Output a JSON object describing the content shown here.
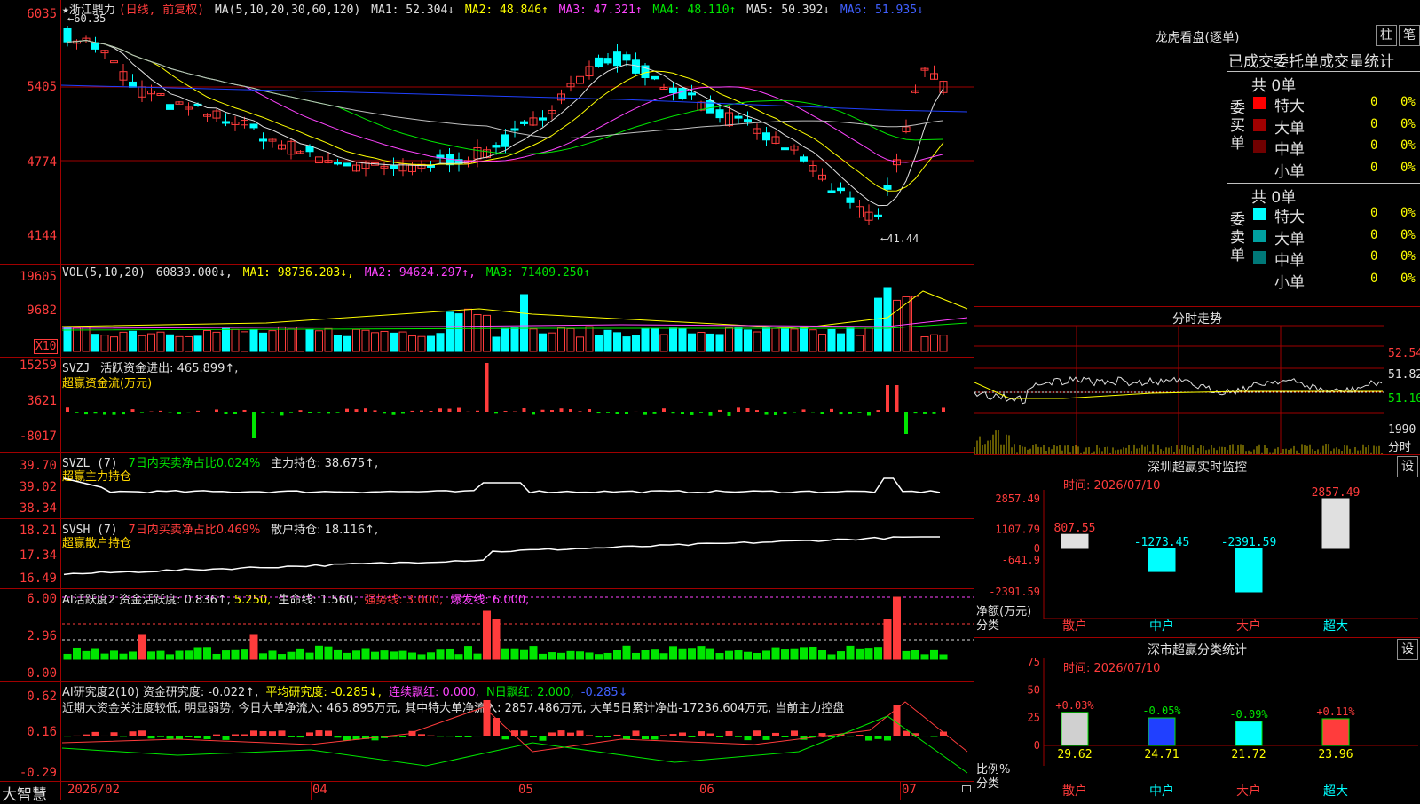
{
  "toolbar": {
    "app_name": "大智慧"
  },
  "main": {
    "stock": "★浙江鼎力",
    "mode": "(日线, 前复权)",
    "ma_label": "MA(5,10,20,30,60,120)",
    "ma": [
      "MA1: 52.304↓",
      "MA2: 48.846↑",
      "MA3: 47.321↑",
      "MA4: 48.110↑",
      "MA5: 50.392↓",
      "MA6: 51.935↓"
    ],
    "y_ticks": [
      "6035",
      "5405",
      "4774",
      "4144"
    ],
    "high_mark": "←60.35",
    "low_mark": "←41.44"
  },
  "vol": {
    "label": "VOL(5,10,20)",
    "value": "60839.000↓,",
    "ma": [
      "MA1: 98736.203↓,",
      "MA2: 94624.297↑,",
      "MA3: 71409.250↑"
    ],
    "y_ticks": [
      "19605",
      "9682"
    ],
    "unit": "X10"
  },
  "svzj": {
    "label": "SVZJ",
    "text1": "活跃资金进出: 465.899↑,",
    "text2": "超赢资金流(万元)",
    "y_ticks": [
      "15259",
      "3621",
      "-8017"
    ]
  },
  "svzl": {
    "label": "SVZL (7)",
    "t1": "7日内买卖净占比0.024%",
    "t2": "主力持仓: 38.675↑,",
    "t3": "超赢主力持仓",
    "y_ticks": [
      "39.70",
      "39.02",
      "38.34"
    ]
  },
  "svsh": {
    "label": "SVSH (7)",
    "t1": "7日内买卖净占比0.469%",
    "t2": "散户持仓: 18.116↑,",
    "t3": "超赢散户持仓",
    "y_ticks": [
      "18.21",
      "17.34",
      "16.49"
    ]
  },
  "ai1": {
    "t1": "AI活跃度2 资金活跃度: 0.836↑,",
    "t2": "5.250,",
    "t3": "生命线: 1.560,",
    "t4": "强势线: 3.000,",
    "t5": "爆发线: 6.000,",
    "y_ticks": [
      "6.00",
      "2.96",
      "0.00"
    ]
  },
  "ai2": {
    "t1": "AI研究度2(10) 资金研究度: -0.022↑,",
    "t2": "平均研究度: -0.285↓,",
    "t3": "连续飘红: 0.000,",
    "t4": "N日飘红: 2.000,",
    "t5": "-0.285↓",
    "comment": "近期大资金关注度较低, 明显弱势, 今日大单净流入: 465.895万元, 其中特大单净流入: 2857.486万元, 大单5日累计净出-17236.604万元, 当前主力控盘",
    "y_ticks": [
      "0.62",
      "0.16",
      "-0.29"
    ]
  },
  "x_axis": [
    "2026/02",
    "04",
    "05",
    "06",
    "07"
  ],
  "lhb": {
    "title": "龙虎看盘(逐单)",
    "btn1": "柱",
    "btn2": "笔",
    "subtitle": "已成交委托单成交量统计",
    "buy": {
      "side": "委买单",
      "total": "共 0单",
      "rows": [
        {
          "name": "特大",
          "v": "0",
          "p": "0%"
        },
        {
          "name": "大单",
          "v": "0",
          "p": "0%"
        },
        {
          "name": "中单",
          "v": "0",
          "p": "0%"
        },
        {
          "name": "小单",
          "v": "0",
          "p": "0%"
        }
      ]
    },
    "sell": {
      "side": "委卖单",
      "total": "共 0单",
      "rows": [
        {
          "name": "特大",
          "v": "0",
          "p": "0%"
        },
        {
          "name": "大单",
          "v": "0",
          "p": "0%"
        },
        {
          "name": "中单",
          "v": "0",
          "p": "0%"
        },
        {
          "name": "小单",
          "v": "0",
          "p": "0%"
        }
      ]
    }
  },
  "fenshi": {
    "title": "分时走势",
    "y": [
      "52.54",
      "51.82",
      "51.10"
    ],
    "vol": "1990",
    "unit": "分时"
  },
  "sz_monitor": {
    "title": "深圳超赢实时监控",
    "btn": "设",
    "time": "时间: 2026/07/10",
    "y": [
      "2857.49",
      "1107.79",
      "0",
      "-641.9",
      "-2391.59"
    ],
    "bars": [
      {
        "label": "散户",
        "value": 807.55,
        "text": "807.55"
      },
      {
        "label": "中户",
        "value": -1273.45,
        "text": "-1273.45"
      },
      {
        "label": "大户",
        "value": -2391.59,
        "text": "-2391.59"
      },
      {
        "label": "超大",
        "value": 2857.49,
        "text": "2857.49"
      }
    ],
    "unit1": "净额(万元)",
    "unit2": "分类"
  },
  "sz_class": {
    "title": "深市超赢分类统计",
    "btn": "设",
    "time": "时间: 2026/07/10",
    "y": [
      "75",
      "50",
      "25",
      "0"
    ],
    "bars": [
      {
        "label": "散户",
        "value": 29.62,
        "text": "29.62",
        "delta": "+0.03%"
      },
      {
        "label": "中户",
        "value": 24.71,
        "text": "24.71",
        "delta": "-0.05%"
      },
      {
        "label": "大户",
        "value": 21.72,
        "text": "21.72",
        "delta": "-0.09%"
      },
      {
        "label": "超大",
        "value": 23.96,
        "text": "23.96",
        "delta": "+0.11%"
      }
    ],
    "unit1": "比例%",
    "unit2": "分类"
  },
  "colors": {
    "up": "#ff3c3c",
    "down": "#00ffff",
    "grid": "#a00000"
  }
}
